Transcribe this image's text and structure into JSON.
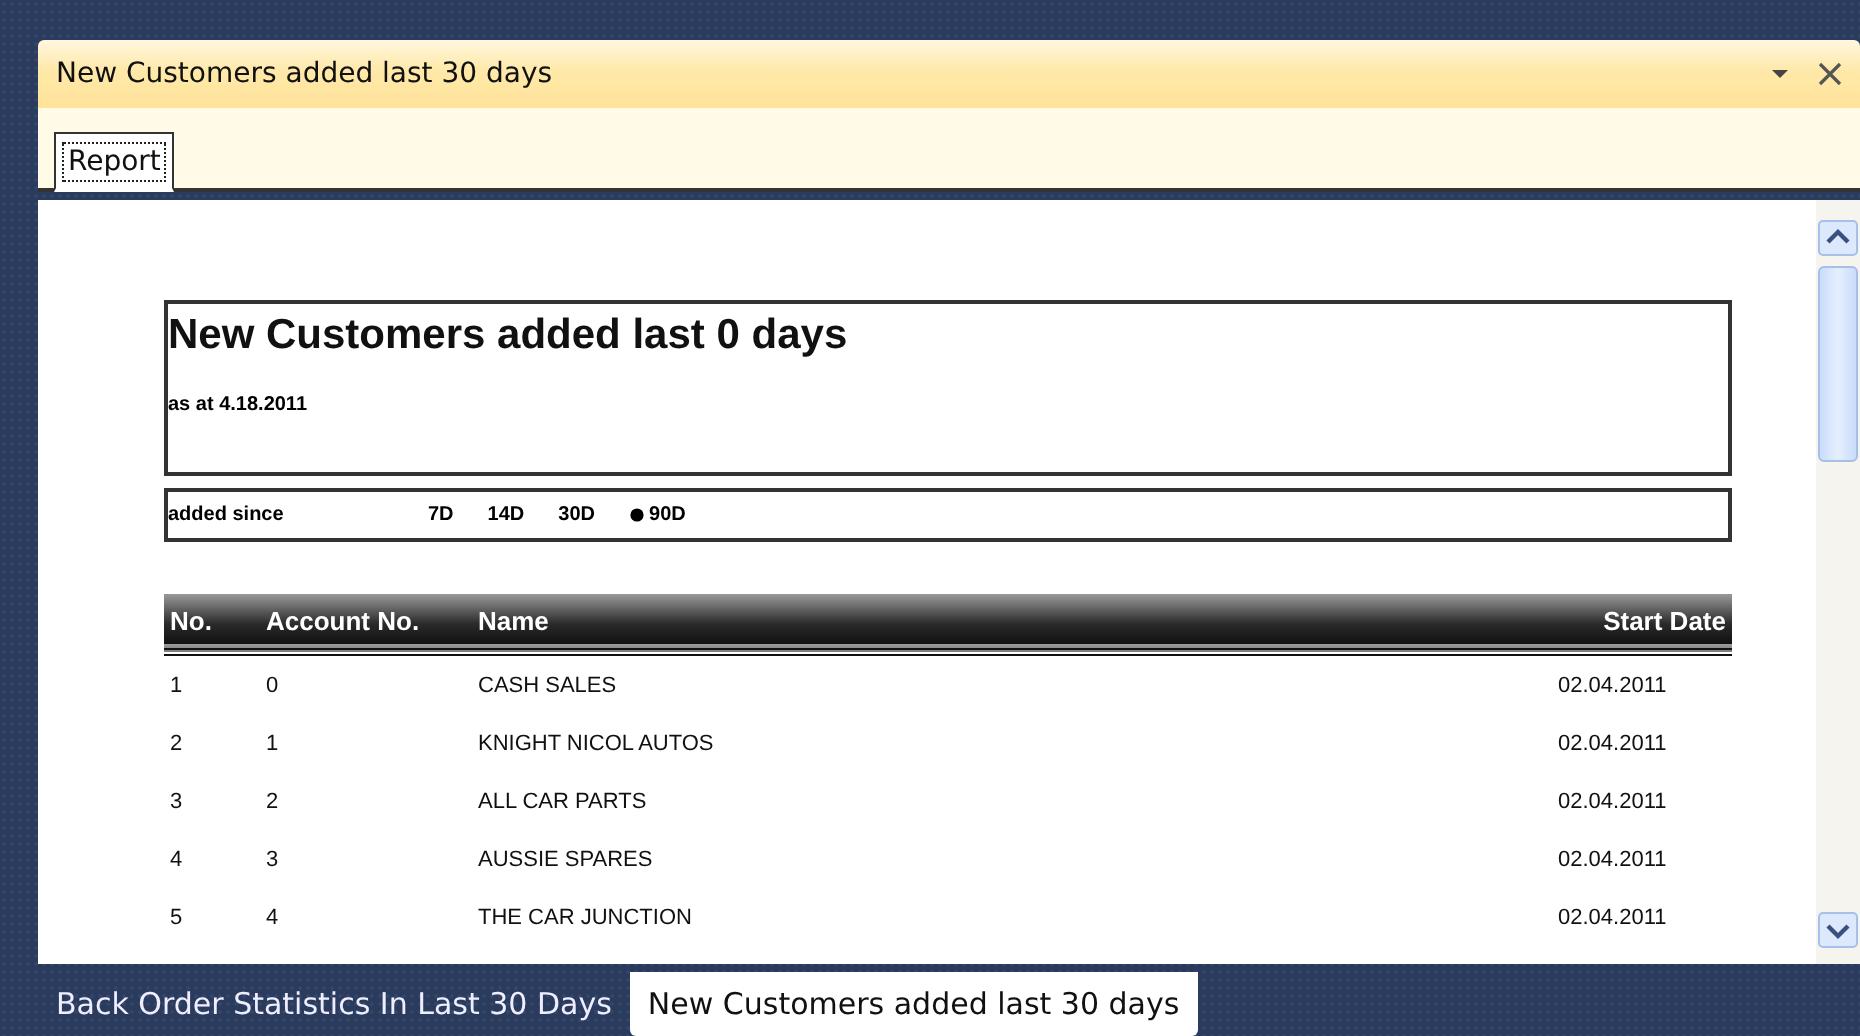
{
  "panel": {
    "title": "New Customers added last 30 days"
  },
  "tabs": [
    {
      "label": "Report",
      "selected": true
    }
  ],
  "report": {
    "title": "New Customers added last 0 days",
    "subtitle": "as at 4.18.2011",
    "filter_label": "added since",
    "filter_options": [
      {
        "label": "7D",
        "selected": false
      },
      {
        "label": "14D",
        "selected": false
      },
      {
        "label": "30D",
        "selected": false
      },
      {
        "label": "90D",
        "selected": true
      }
    ],
    "table": {
      "columns": [
        "No.",
        "Account No.",
        "Name",
        "Start Date"
      ],
      "rows": [
        [
          "1",
          "0",
          "CASH SALES",
          "02.04.2011"
        ],
        [
          "2",
          "1",
          "KNIGHT NICOL AUTOS",
          "02.04.2011"
        ],
        [
          "3",
          "2",
          "ALL CAR PARTS",
          "02.04.2011"
        ],
        [
          "4",
          "3",
          "AUSSIE SPARES",
          "02.04.2011"
        ],
        [
          "5",
          "4",
          "THE CAR JUNCTION",
          "02.04.2011"
        ]
      ]
    }
  },
  "document_tabs": [
    {
      "label": "Back Order Statistics In Last 30 Days",
      "selected": false
    },
    {
      "label": "New Customers added last 30 days",
      "selected": true
    }
  ]
}
